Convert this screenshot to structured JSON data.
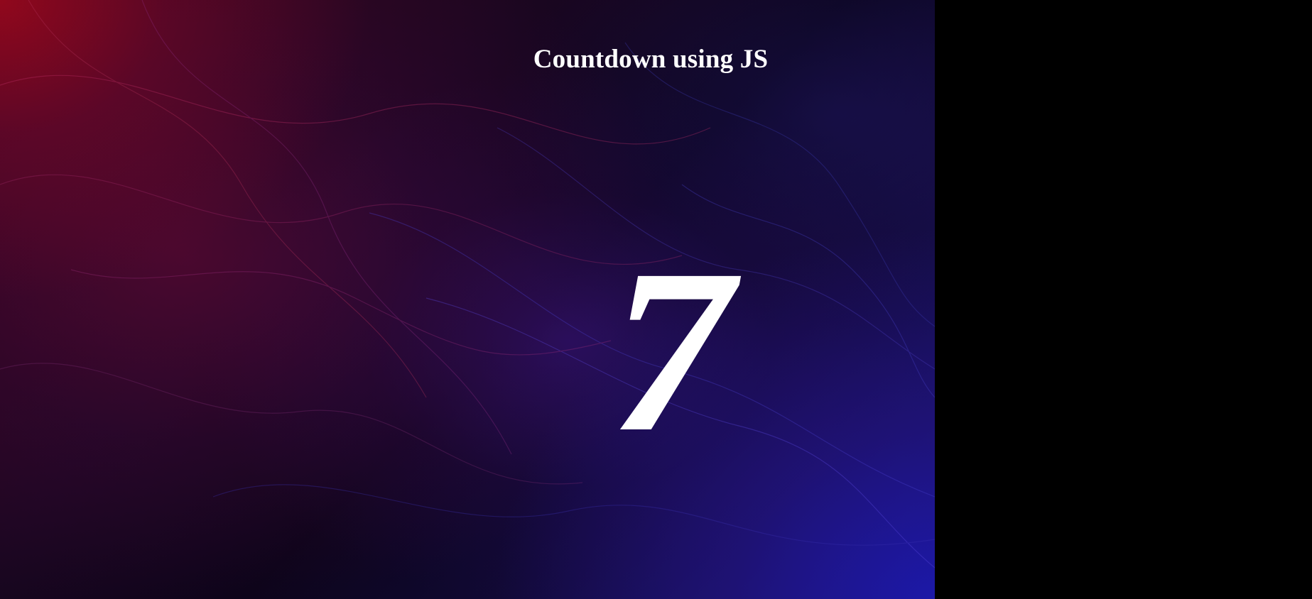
{
  "page": {
    "title": "Countdown using JS",
    "countdown_value": "7"
  },
  "colors": {
    "text": "#ffffff",
    "page_background": "#000000",
    "gradient_red": "#a0081c",
    "gradient_blue": "#1c18aa"
  }
}
